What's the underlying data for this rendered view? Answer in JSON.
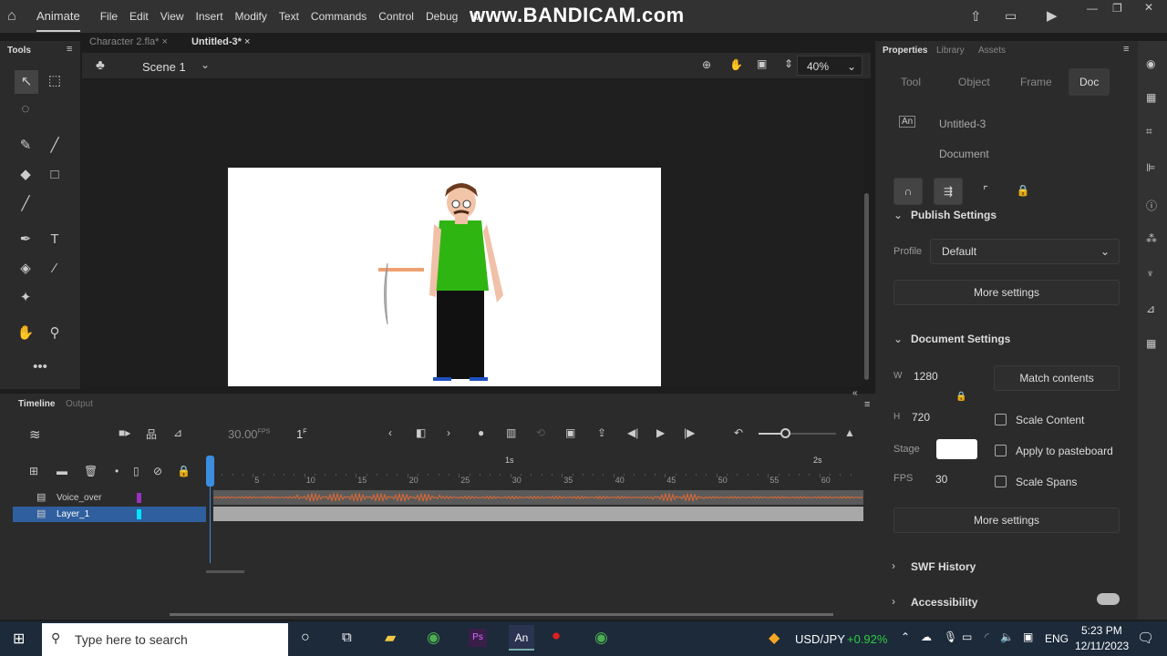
{
  "menubar": {
    "app": "Animate",
    "items": [
      "File",
      "Edit",
      "View",
      "Insert",
      "Modify",
      "Text",
      "Commands",
      "Control",
      "Debug",
      "W"
    ]
  },
  "watermark": "www.BANDICAM.com",
  "tabs": [
    {
      "label": "Character 2.fla*"
    },
    {
      "label": "Untitled-3*"
    }
  ],
  "tools": {
    "title": "Tools"
  },
  "scene": {
    "name": "Scene 1",
    "zoom": "40%"
  },
  "timeline": {
    "tabs": [
      "Timeline",
      "Output"
    ],
    "fps": "30.00",
    "fps_unit": "FPS",
    "frame": "1",
    "frame_unit": "F",
    "ruler": [
      "5",
      "10",
      "15",
      "20",
      "25",
      "30",
      "35",
      "40",
      "45",
      "50",
      "55",
      "60"
    ],
    "seconds": [
      "1s",
      "2s"
    ],
    "layers": [
      {
        "name": "Voice_over",
        "color": "#9b30c0",
        "selected": false
      },
      {
        "name": "Layer_1",
        "color": "#00e5ff",
        "selected": true
      }
    ]
  },
  "properties": {
    "panel_tabs": [
      "Properties",
      "Library",
      "Assets"
    ],
    "subtabs": [
      "Tool",
      "Object",
      "Frame",
      "Doc"
    ],
    "active_subtab": "Doc",
    "doc_name": "Untitled-3",
    "doc_type": "Document",
    "publish": {
      "title": "Publish Settings",
      "profile_label": "Profile",
      "profile": "Default",
      "more": "More settings"
    },
    "document": {
      "title": "Document Settings",
      "w_label": "W",
      "w": "1280",
      "h_label": "H",
      "h": "720",
      "match": "Match contents",
      "scale_content": "Scale Content",
      "apply_paste": "Apply to pasteboard",
      "scale_spans": "Scale Spans",
      "stage_label": "Stage",
      "stage_color": "#ffffff",
      "fps_label": "FPS",
      "fps": "30",
      "more": "More settings"
    },
    "swf_history": "SWF History",
    "accessibility": "Accessibility"
  },
  "taskbar": {
    "search": "Type here to search",
    "ticker": "USD/JPY",
    "change": "+0.92%",
    "lang": "ENG",
    "time": "5:23 PM",
    "date": "12/11/2023"
  }
}
